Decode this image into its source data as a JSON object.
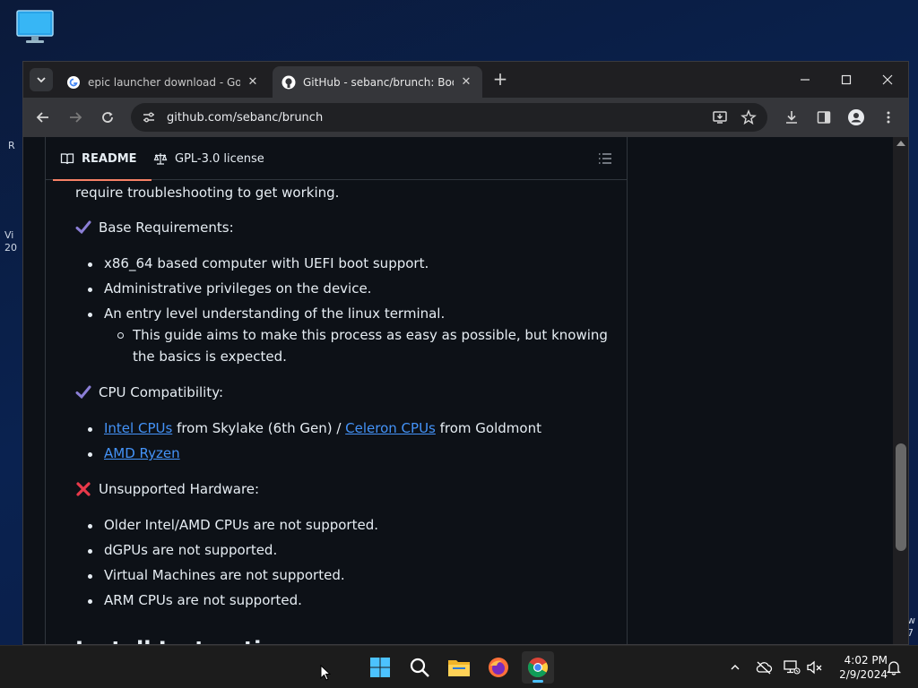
{
  "browser": {
    "tabs": [
      {
        "title": "epic launcher download - Goog",
        "favicon": "google-icon",
        "active": false
      },
      {
        "title": "GitHub - sebanc/brunch: Boot C",
        "favicon": "github-icon",
        "active": true
      }
    ],
    "address": "github.com/sebanc/brunch"
  },
  "readme": {
    "tabs": {
      "readme": "README",
      "license": "GPL-3.0 license"
    },
    "intro_tail": "require troubleshooting to get working.",
    "base_heading": "Base Requirements:",
    "base_items": [
      "x86_64 based computer with UEFI boot support.",
      "Administrative privileges on the device.",
      "An entry level understanding of the linux terminal."
    ],
    "base_sub_item": "This guide aims to make this process as easy as possible, but knowing the basics is expected.",
    "cpu_heading": "CPU Compatibility:",
    "cpu_item1": {
      "link1": "Intel CPUs",
      "mid": " from Skylake (6th Gen) / ",
      "link2": "Celeron CPUs",
      "tail": " from Goldmont"
    },
    "cpu_item2": "AMD Ryzen",
    "unsupported_heading": "Unsupported Hardware:",
    "unsupported_items": [
      "Older Intel/AMD CPUs are not supported.",
      "dGPUs are not supported.",
      "Virtual Machines are not supported.",
      "ARM CPUs are not supported."
    ],
    "next_heading_partial": "Install Instructions"
  },
  "taskbar": {
    "time": "4:02 PM",
    "date": "2/9/2024"
  },
  "colors": {
    "link": "#4493f8",
    "check": "#8b7fd6",
    "cross": "#e8394a",
    "accent": "#f78166"
  }
}
